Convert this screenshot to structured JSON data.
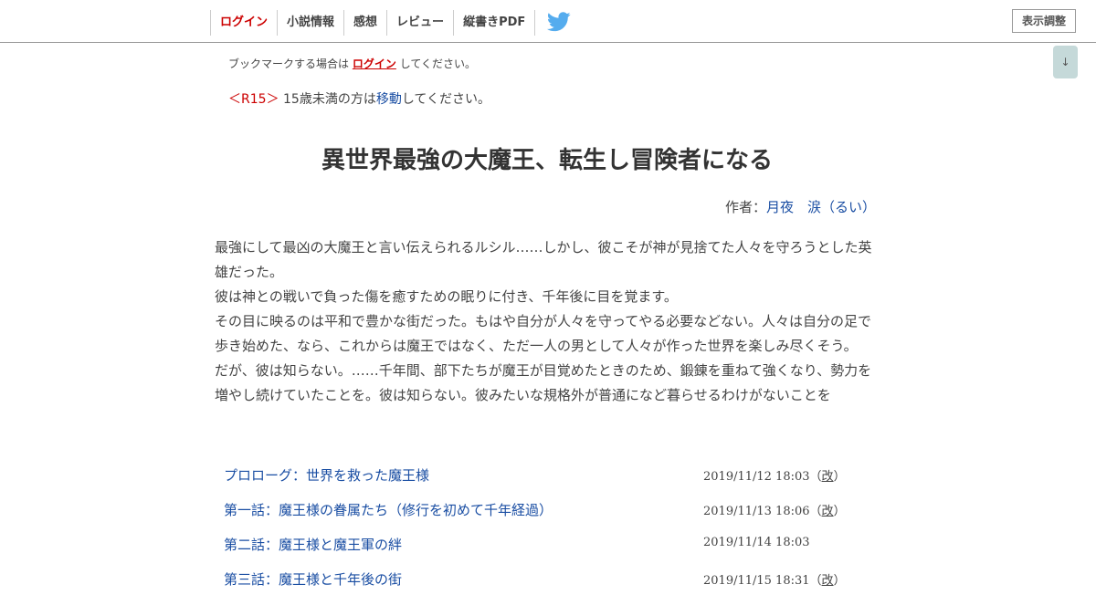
{
  "nav": {
    "login": "ログイン",
    "novel_info": "小説情報",
    "impressions": "感想",
    "review": "レビュー",
    "vertical_pdf": "縦書きPDF",
    "display_settings": "表示調整",
    "scroll_down": "↓",
    "twitter_icon": "twitter-bird-icon",
    "twitter_color": "#55acee"
  },
  "bookmark": {
    "prefix": "ブックマークする場合は",
    "login_link": "ログイン",
    "suffix": "してください。"
  },
  "r15": {
    "tag": "＜R15＞",
    "prefix": "15歳未満の方は",
    "link": "移動",
    "suffix": "してください。"
  },
  "novel": {
    "title": "異世界最強の大魔王、転生し冒険者になる",
    "author_label": "作者：",
    "author_name": "月夜　涙（るい）",
    "synopsis": [
      "最強にして最凶の大魔王と言い伝えられるルシル……しかし、彼こそが神が見捨てた人々を守ろうとした英雄だった。",
      "彼は神との戦いで負った傷を癒すための眠りに付き、千年後に目を覚ます。",
      "その目に映るのは平和で豊かな街だった。もはや自分が人々を守ってやる必要などない。人々は自分の足で歩き始めた、なら、これからは魔王ではなく、ただ一人の男として人々が作った世界を楽しみ尽くそう。",
      "だが、彼は知らない。……千年間、部下たちが魔王が目覚めたときのため、鍛錬を重ねて強くなり、勢力を増やし続けていたことを。彼は知らない。彼みたいな規格外が普通になど暮らせるわけがないことを"
    ]
  },
  "chapters": [
    {
      "title": "プロローグ：世界を救った魔王様",
      "date": "2019/11/12 18:03",
      "revised_open": "（",
      "revised": "改",
      "revised_close": "）"
    },
    {
      "title": "第一話：魔王様の眷属たち（修行を初めて千年経過）",
      "date": "2019/11/13 18:06",
      "revised_open": "（",
      "revised": "改",
      "revised_close": "）"
    },
    {
      "title": "第二話：魔王様と魔王軍の絆",
      "date": "2019/11/14 18:03",
      "revised_open": "",
      "revised": "",
      "revised_close": ""
    },
    {
      "title": "第三話：魔王様と千年後の街",
      "date": "2019/11/15 18:31",
      "revised_open": "（",
      "revised": "改",
      "revised_close": "）"
    }
  ],
  "colors": {
    "login_red": "#cc0000",
    "link_blue": "#1a4ea3",
    "scroll_button_bg": "#c5d9d9"
  }
}
